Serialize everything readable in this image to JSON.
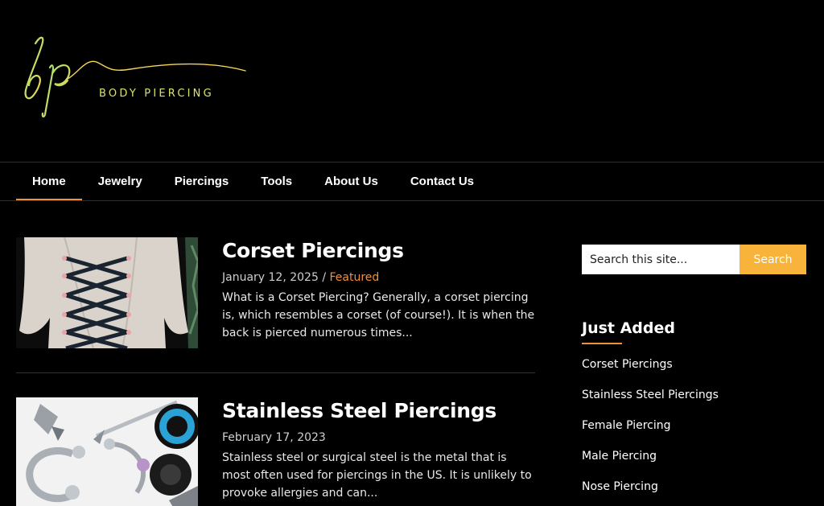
{
  "site": {
    "logo_monogram": "bp",
    "logo_text": "BODY PIERCING"
  },
  "nav": {
    "items": [
      {
        "label": "Home",
        "active": true
      },
      {
        "label": "Jewelry",
        "active": false
      },
      {
        "label": "Piercings",
        "active": false
      },
      {
        "label": "Tools",
        "active": false
      },
      {
        "label": "About Us",
        "active": false
      },
      {
        "label": "Contact Us",
        "active": false
      }
    ]
  },
  "posts": [
    {
      "title": "Corset Piercings",
      "date": "January 12, 2025",
      "separator": " / ",
      "category": "Featured",
      "excerpt": "What is a Corset Piercing? Generally, a corset piercing is, which resembles a corset (of course!). It is when the back is pierced numerous times..."
    },
    {
      "title": "Stainless Steel Piercings",
      "date": "February 17, 2023",
      "excerpt": "Stainless steel or surgical steel is the metal that is most often used for piercings in the US. It is unlikely to provoke allergies and can..."
    }
  ],
  "sidebar": {
    "search": {
      "placeholder": "Search this site...",
      "button_label": "Search"
    },
    "recent": {
      "title": "Just Added",
      "items": [
        "Corset Piercings",
        "Stainless Steel Piercings",
        "Female Piercing",
        "Male Piercing",
        "Nose Piercing"
      ]
    }
  },
  "colors": {
    "background": "#000000",
    "accent": "#f0903a",
    "search_button": "#f8b43a",
    "logo_green": "#a8e06a",
    "logo_yellow": "#f5d45a"
  }
}
